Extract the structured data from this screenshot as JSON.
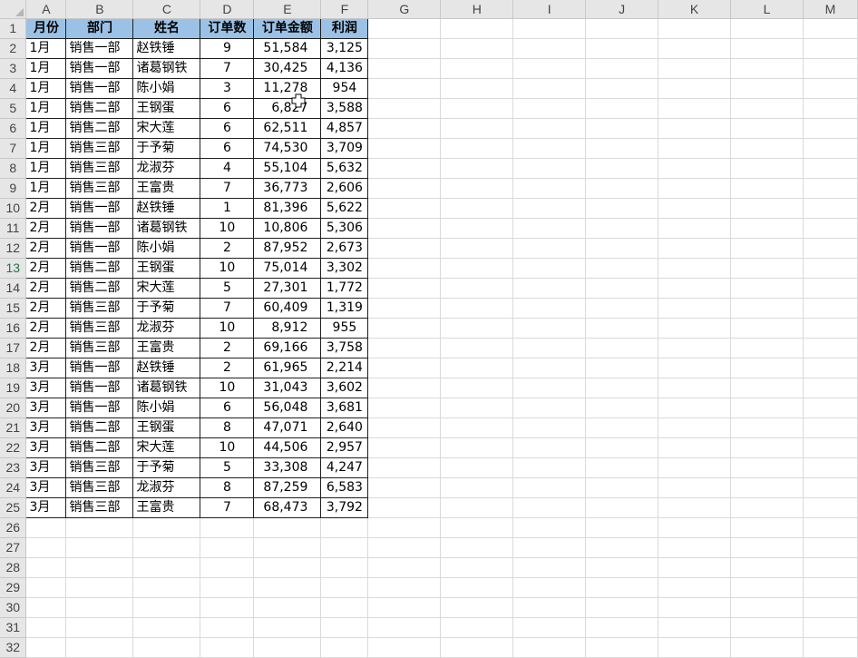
{
  "columns": [
    "A",
    "B",
    "C",
    "D",
    "E",
    "F",
    "G",
    "H",
    "I",
    "J",
    "K",
    "L",
    "M"
  ],
  "row_numbers": [
    "1",
    "2",
    "3",
    "4",
    "5",
    "6",
    "7",
    "8",
    "9",
    "10",
    "11",
    "12",
    "13",
    "14",
    "15",
    "16",
    "17",
    "18",
    "19",
    "20",
    "21",
    "22",
    "23",
    "24",
    "25",
    "26",
    "27",
    "28",
    "29",
    "30",
    "31",
    "32"
  ],
  "table": {
    "headers": [
      "月份",
      "部门",
      "姓名",
      "订单数",
      "订单金额",
      "利润"
    ],
    "rows": [
      [
        "1月",
        "销售一部",
        "赵铁锤",
        "9",
        "51,584",
        "3,125"
      ],
      [
        "1月",
        "销售一部",
        "诸葛钢铁",
        "7",
        "30,425",
        "4,136"
      ],
      [
        "1月",
        "销售一部",
        "陈小娟",
        "3",
        "11,278",
        "954"
      ],
      [
        "1月",
        "销售二部",
        "王钢蛋",
        "6",
        "6,827",
        "3,588"
      ],
      [
        "1月",
        "销售二部",
        "宋大莲",
        "6",
        "62,511",
        "4,857"
      ],
      [
        "1月",
        "销售三部",
        "于予菊",
        "6",
        "74,530",
        "3,709"
      ],
      [
        "1月",
        "销售三部",
        "龙淑芬",
        "4",
        "55,104",
        "5,632"
      ],
      [
        "1月",
        "销售三部",
        "王富贵",
        "7",
        "36,773",
        "2,606"
      ],
      [
        "2月",
        "销售一部",
        "赵铁锤",
        "1",
        "81,396",
        "5,622"
      ],
      [
        "2月",
        "销售一部",
        "诸葛钢铁",
        "10",
        "10,806",
        "5,306"
      ],
      [
        "2月",
        "销售一部",
        "陈小娟",
        "2",
        "87,952",
        "2,673"
      ],
      [
        "2月",
        "销售二部",
        "王钢蛋",
        "10",
        "75,014",
        "3,302"
      ],
      [
        "2月",
        "销售二部",
        "宋大莲",
        "5",
        "27,301",
        "1,772"
      ],
      [
        "2月",
        "销售三部",
        "于予菊",
        "7",
        "60,409",
        "1,319"
      ],
      [
        "2月",
        "销售三部",
        "龙淑芬",
        "10",
        "8,912",
        "955"
      ],
      [
        "2月",
        "销售三部",
        "王富贵",
        "2",
        "69,166",
        "3,758"
      ],
      [
        "3月",
        "销售一部",
        "赵铁锤",
        "2",
        "61,965",
        "2,214"
      ],
      [
        "3月",
        "销售一部",
        "诸葛钢铁",
        "10",
        "31,043",
        "3,602"
      ],
      [
        "3月",
        "销售一部",
        "陈小娟",
        "6",
        "56,048",
        "3,681"
      ],
      [
        "3月",
        "销售二部",
        "王钢蛋",
        "8",
        "47,071",
        "2,640"
      ],
      [
        "3月",
        "销售二部",
        "宋大莲",
        "10",
        "44,506",
        "2,957"
      ],
      [
        "3月",
        "销售三部",
        "于予菊",
        "5",
        "33,308",
        "4,247"
      ],
      [
        "3月",
        "销售三部",
        "龙淑芬",
        "8",
        "87,259",
        "6,583"
      ],
      [
        "3月",
        "销售三部",
        "王富贵",
        "7",
        "68,473",
        "3,792"
      ]
    ]
  },
  "active_row": "13",
  "colors": {
    "header_fill": "#9bc2e6",
    "sheet_header_bg": "#e6e6e6",
    "active_row_number": "#217346"
  },
  "cursor_icon": "cell-select-plus-cursor"
}
